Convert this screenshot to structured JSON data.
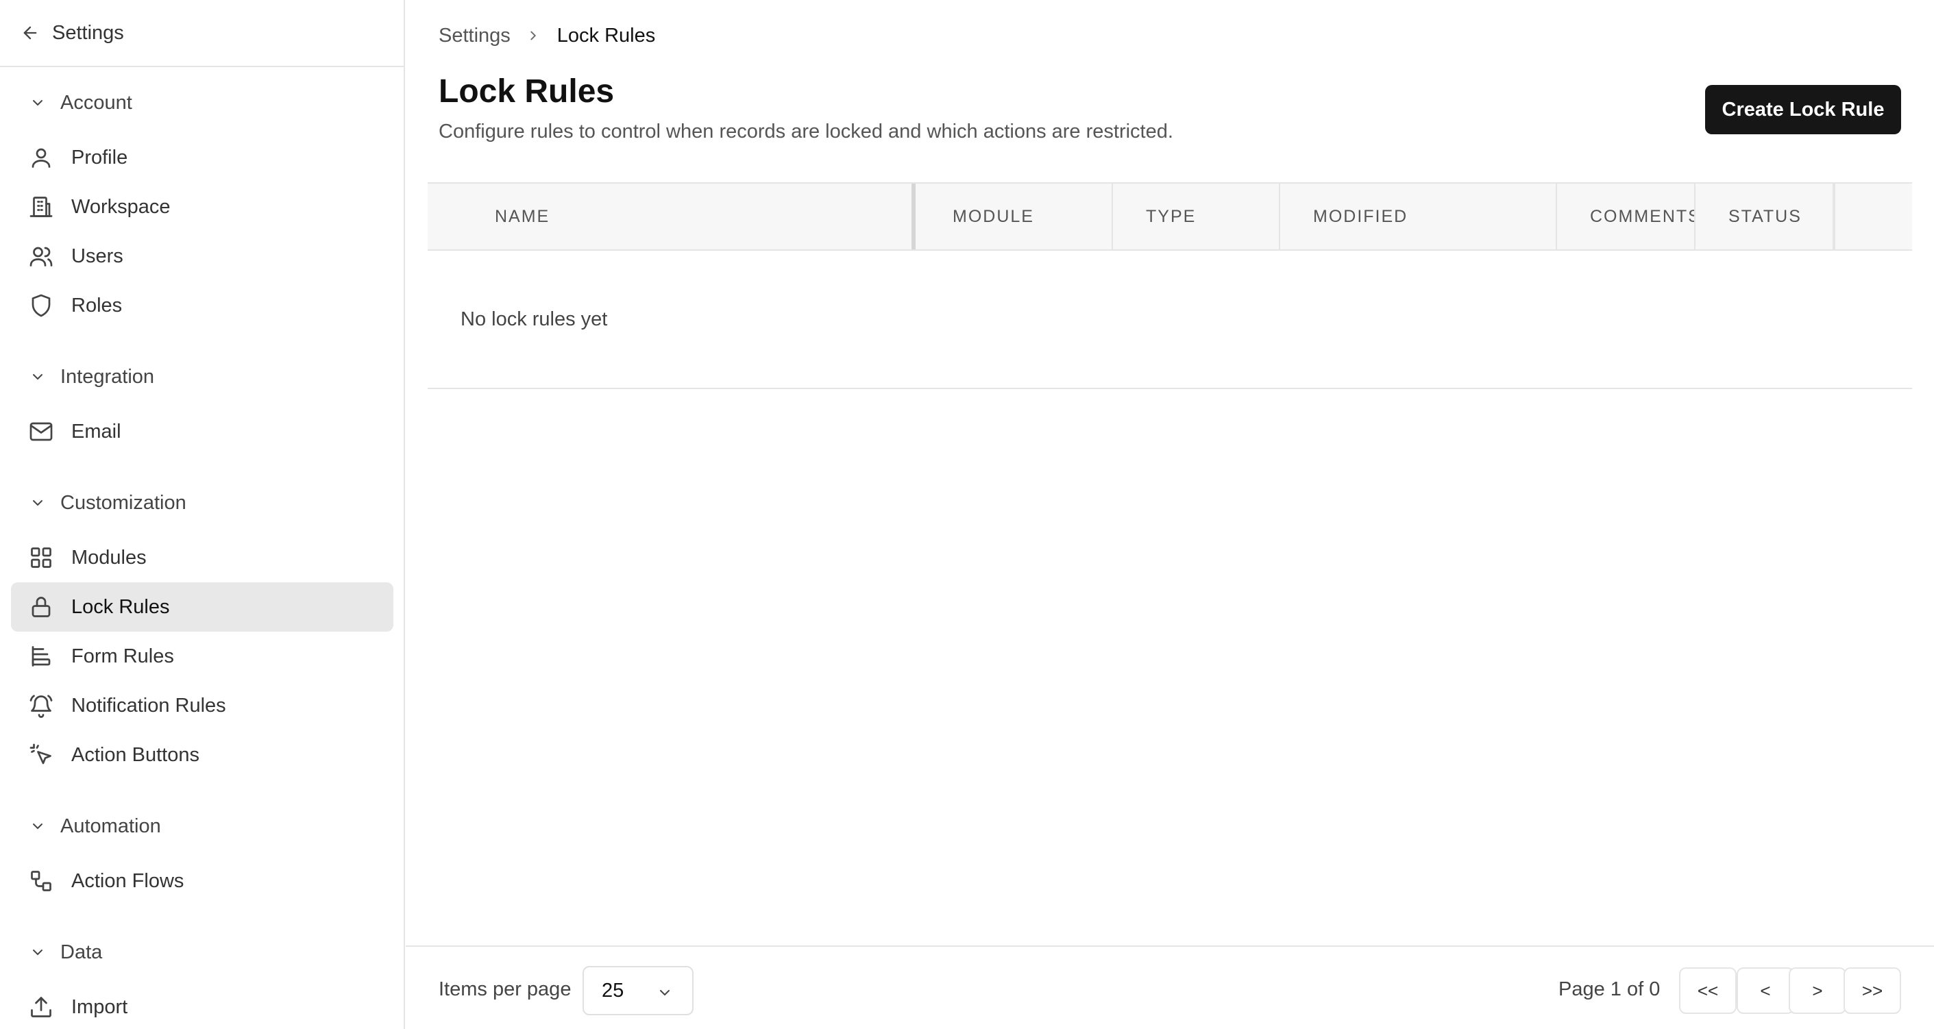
{
  "sidebar": {
    "header": {
      "title": "Settings",
      "icon": "arrow-left-icon"
    },
    "sections": [
      {
        "label": "Account",
        "items": [
          {
            "label": "Profile",
            "icon": "user-icon"
          },
          {
            "label": "Workspace",
            "icon": "building-icon"
          },
          {
            "label": "Users",
            "icon": "users-icon"
          },
          {
            "label": "Roles",
            "icon": "shield-icon"
          }
        ]
      },
      {
        "label": "Integration",
        "items": [
          {
            "label": "Email",
            "icon": "mail-icon"
          }
        ]
      },
      {
        "label": "Customization",
        "items": [
          {
            "label": "Modules",
            "icon": "grid-icon"
          },
          {
            "label": "Lock Rules",
            "icon": "lock-icon",
            "active": true
          },
          {
            "label": "Form Rules",
            "icon": "form-icon"
          },
          {
            "label": "Notification Rules",
            "icon": "bell-icon"
          },
          {
            "label": "Action Buttons",
            "icon": "pointer-click-icon"
          }
        ]
      },
      {
        "label": "Automation",
        "items": [
          {
            "label": "Action Flows",
            "icon": "workflow-icon"
          }
        ]
      },
      {
        "label": "Data",
        "items": [
          {
            "label": "Import",
            "icon": "upload-icon"
          }
        ]
      }
    ]
  },
  "breadcrumb": {
    "parent": "Settings",
    "current": "Lock Rules"
  },
  "page": {
    "title": "Lock Rules",
    "description": "Configure rules to control when records are locked and which actions are restricted.",
    "create_button": "Create Lock Rule"
  },
  "table": {
    "columns": [
      "NAME",
      "MODULE",
      "TYPE",
      "MODIFIED",
      "COMMENTS",
      "STATUS"
    ],
    "empty_message": "No lock rules yet"
  },
  "pagination": {
    "items_per_page_label": "Items per page",
    "items_per_page_value": "25",
    "page_info": "Page 1 of 0",
    "first": "<<",
    "prev": "<",
    "next": ">",
    "last": ">>"
  }
}
